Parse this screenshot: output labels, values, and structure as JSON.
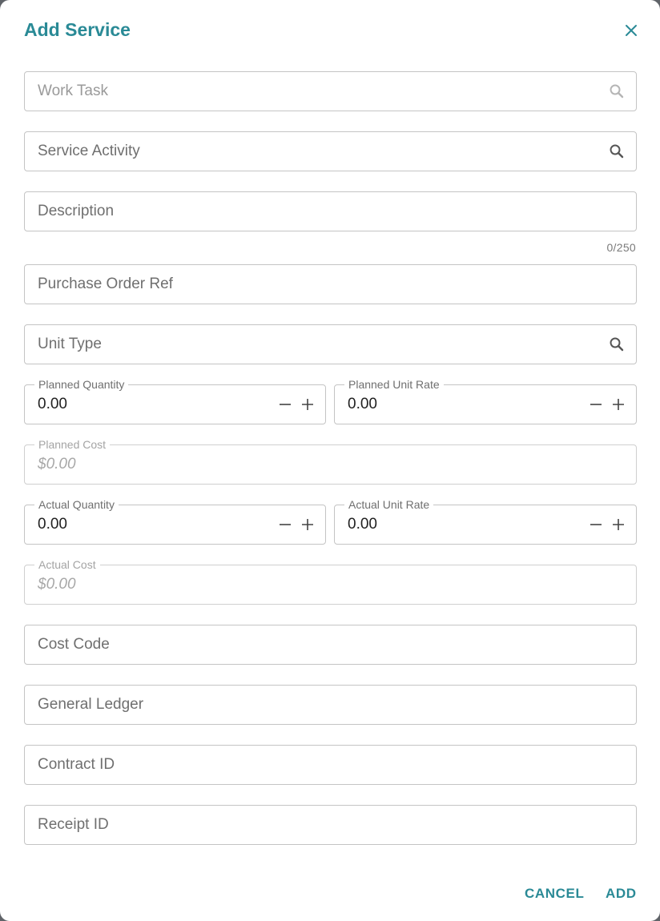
{
  "dialog": {
    "title": "Add Service",
    "close_icon": "close-icon",
    "accent_color": "#2a8a96"
  },
  "fields": {
    "work_task": {
      "placeholder": "Work Task",
      "icon": "search-icon"
    },
    "service_activity": {
      "placeholder": "Service Activity",
      "icon": "search-icon"
    },
    "description": {
      "placeholder": "Description",
      "counter": "0/250"
    },
    "purchase_order_ref": {
      "placeholder": "Purchase Order Ref"
    },
    "unit_type": {
      "placeholder": "Unit Type",
      "icon": "search-icon"
    },
    "planned_quantity": {
      "label": "Planned Quantity",
      "value": "0.00"
    },
    "planned_unit_rate": {
      "label": "Planned Unit Rate",
      "value": "0.00"
    },
    "planned_cost": {
      "label": "Planned Cost",
      "value": "$0.00"
    },
    "actual_quantity": {
      "label": "Actual Quantity",
      "value": "0.00"
    },
    "actual_unit_rate": {
      "label": "Actual Unit Rate",
      "value": "0.00"
    },
    "actual_cost": {
      "label": "Actual Cost",
      "value": "$0.00"
    },
    "cost_code": {
      "placeholder": "Cost Code"
    },
    "general_ledger": {
      "placeholder": "General Ledger"
    },
    "contract_id": {
      "placeholder": "Contract ID"
    },
    "receipt_id": {
      "placeholder": "Receipt ID"
    }
  },
  "actions": {
    "cancel_label": "CANCEL",
    "add_label": "ADD"
  }
}
